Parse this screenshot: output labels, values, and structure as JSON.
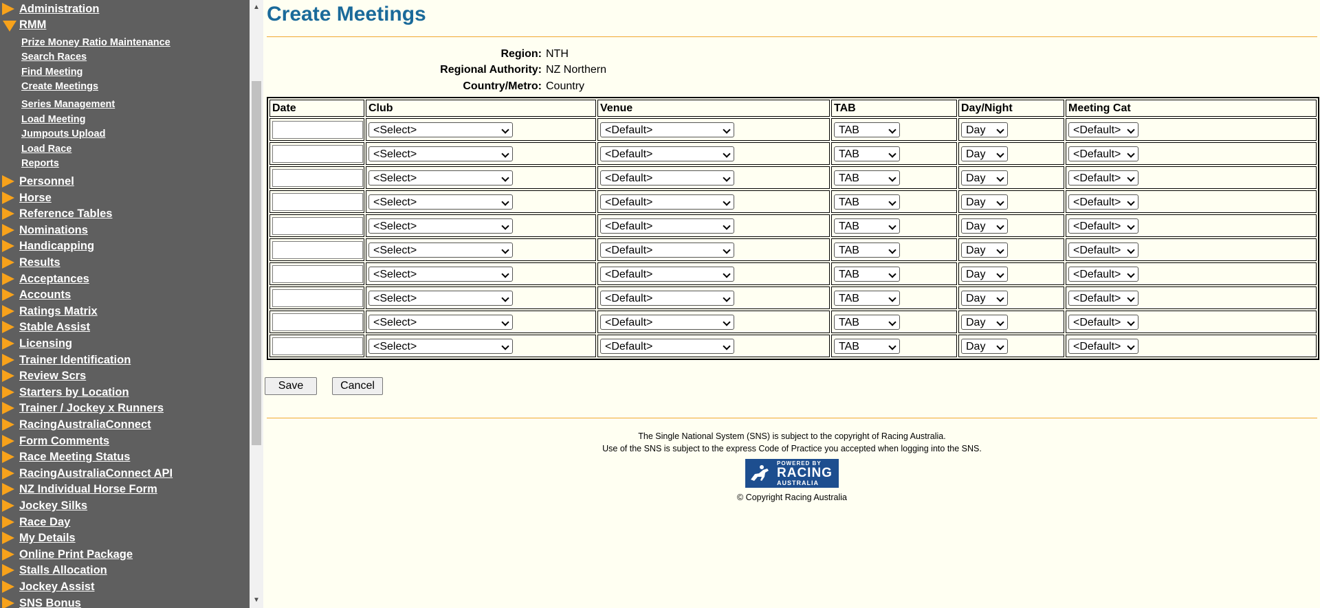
{
  "sidebar": {
    "top_items": [
      {
        "label": "Administration",
        "open": false
      },
      {
        "label": "RMM",
        "open": true
      }
    ],
    "sub_items": [
      "Prize Money Ratio Maintenance",
      "Search Races",
      "Find Meeting",
      "Create Meetings",
      "Series Management",
      "Load Meeting",
      "Jumpouts Upload",
      "Load Race",
      "Reports"
    ],
    "items": [
      "Personnel",
      "Horse",
      "Reference Tables",
      "Nominations",
      "Handicapping",
      "Results",
      "Acceptances",
      "Accounts",
      "Ratings Matrix",
      "Stable Assist",
      "Licensing",
      "Trainer Identification",
      "Review Scrs",
      "Starters by Location",
      "Trainer / Jockey x Runners",
      "RacingAustraliaConnect",
      "Form Comments",
      "Race Meeting Status",
      "RacingAustraliaConnect API",
      "NZ Individual Horse Form",
      "Jockey Silks",
      "Race Day",
      "My Details",
      "Online Print Package",
      "Stalls Allocation",
      "Jockey Assist",
      "SNS Bonus"
    ]
  },
  "page": {
    "title": "Create Meetings",
    "region_label": "Region:",
    "region_value": "NTH",
    "authority_label": "Regional Authority:",
    "authority_value": "NZ Northern",
    "country_label": "Country/Metro:",
    "country_value": "Country"
  },
  "table": {
    "headers": [
      "Date",
      "Club",
      "Venue",
      "TAB",
      "Day/Night",
      "Meeting Cat"
    ],
    "row_defaults": {
      "date": "",
      "club": "<Select>",
      "venue": "<Default>",
      "tab": "TAB",
      "daynight": "Day",
      "cat": "<Default>"
    },
    "row_count": 10
  },
  "buttons": {
    "save": "Save",
    "cancel": "Cancel"
  },
  "footer": {
    "line1": "The Single National System (SNS) is subject to the copyright of Racing Australia.",
    "line2": "Use of the SNS is subject to the express Code of Practice you accepted when logging into the SNS.",
    "logo_line1": "POWERED BY",
    "logo_line2": "RACING",
    "logo_line3": "AUSTRALIA",
    "copyright": "© Copyright Racing Australia"
  },
  "colors": {
    "sidebar_bg": "#5f5f5f",
    "accent_orange": "#f7a21b",
    "title_blue": "#1a6a9a",
    "page_bg": "#fffff2"
  }
}
